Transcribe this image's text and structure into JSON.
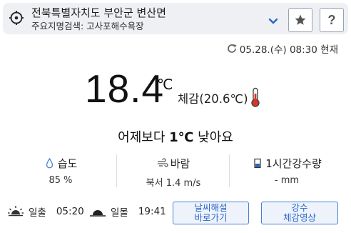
{
  "location": {
    "name": "전북특별자치도 부안군 변산면",
    "landmark": "주요지명검색: 고사포해수욕장"
  },
  "header_buttons": {
    "star": "★",
    "help": "?"
  },
  "timestamp": "05.28.(수) 08:30 현재",
  "weather": {
    "temperature": "18.4",
    "unit": "℃",
    "feels_like": "체감(20.6℃)",
    "comparison_prefix": "어제보다 ",
    "comparison_value": "1℃",
    "comparison_suffix": " 낮아요"
  },
  "stats": {
    "humidity": {
      "label": "습도",
      "value": "85 %"
    },
    "wind": {
      "label": "바람",
      "value": "북서 1.4 m/s"
    },
    "precip": {
      "label": "1시간강수량",
      "value": "- mm"
    }
  },
  "sun": {
    "sunrise_label": "일출",
    "sunrise_time": "05:20",
    "sunset_label": "일몰",
    "sunset_time": "19:41"
  },
  "buttons": {
    "explain_line1": "날씨해설",
    "explain_line2": "바로가기",
    "video_line1": "강수",
    "video_line2": "체감영상"
  },
  "colors": {
    "accent_blue": "#2a66c9",
    "thermo_red": "#d9342b",
    "header_bg": "#eef0f4"
  }
}
